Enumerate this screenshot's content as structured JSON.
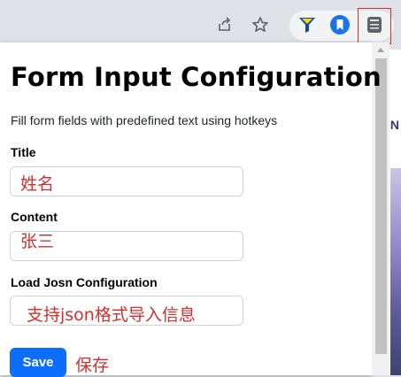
{
  "colors": {
    "annotation": "#d0312d",
    "primary": "#0d6efd",
    "toolbar": "#dee1e6"
  },
  "toolbar": {
    "icons": [
      "share-icon",
      "star-icon",
      "filter-extension-icon",
      "bookmark-extension-icon",
      "form-extension-icon"
    ]
  },
  "background_page": {
    "partial_text": "IN"
  },
  "popup": {
    "title": "Form Input Configuration",
    "subtitle": "Fill form fields with predefined text using hotkeys",
    "fields": [
      {
        "label": "Title",
        "annotation": "姓名"
      },
      {
        "label": "Content",
        "annotation": "张三"
      },
      {
        "label": "Load Josn Configuration",
        "annotation": "支持json格式导入信息"
      }
    ],
    "save_label": "Save",
    "save_annotation": "保存"
  }
}
